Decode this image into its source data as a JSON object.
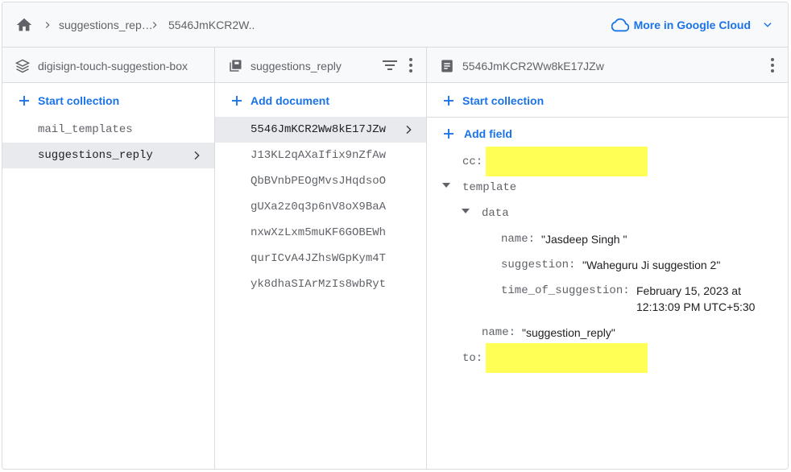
{
  "breadcrumb": {
    "items": [
      "suggestions_rep…",
      "5546JmKCR2W.."
    ],
    "cloud_link": "More in Google Cloud"
  },
  "col1": {
    "title": "digisign-touch-suggestion-box",
    "action": "Start collection",
    "items": [
      "mail_templates",
      "suggestions_reply"
    ]
  },
  "col2": {
    "title": "suggestions_reply",
    "action": "Add document",
    "items": [
      "5546JmKCR2Ww8kE17JZw",
      "J13KL2qAXaIfix9nZfAw",
      "QbBVnbPEOgMvsJHqdsoO",
      "gUXa2z0q3p6nV8oX9BaA",
      "nxwXzLxm5muKF6GOBEWh",
      "qurICvA4JZhsWGpKym4T",
      "yk8dhaSIArMzIs8wbRyt"
    ]
  },
  "col3": {
    "title": "5546JmKCR2Ww8kE17JZw",
    "action": "Start collection",
    "add_field": "Add field",
    "fields": {
      "cc_key": "cc:",
      "template_key": "template",
      "data_key": "data",
      "name_key": "name:",
      "name_val": "\"Jasdeep Singh \"",
      "suggestion_key": "suggestion:",
      "suggestion_val": "\"Waheguru Ji suggestion 2\"",
      "time_key": "time_of_suggestion:",
      "time_val_1": "February 15, 2023 at",
      "time_val_2": "12:13:09 PM UTC+5:30",
      "tname_key": "name:",
      "tname_val": "\"suggestion_reply\"",
      "to_key": "to:"
    }
  },
  "colors": {
    "accent": "#1a73e8",
    "redaction": "#ffff55",
    "selected_row": "#e8eaed"
  }
}
